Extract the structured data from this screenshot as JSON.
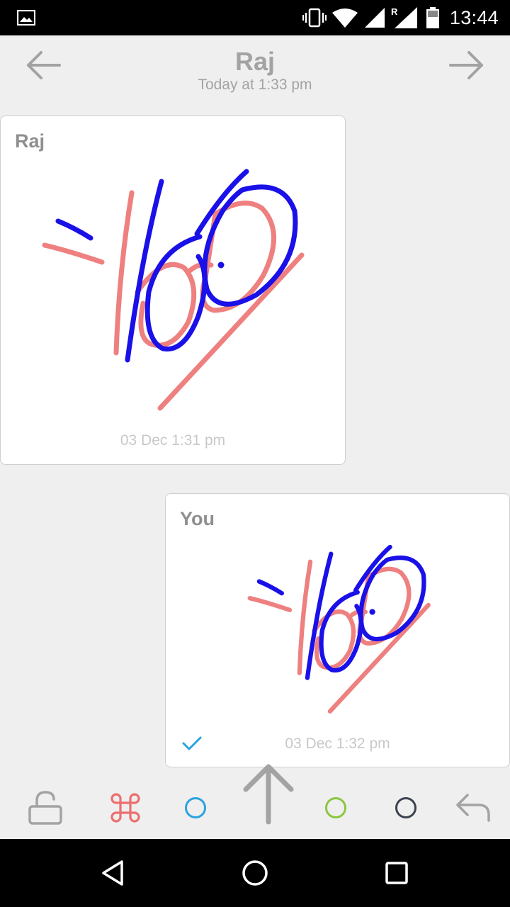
{
  "status_bar": {
    "time": "13:44",
    "icons": [
      "image-icon",
      "vibrate-icon",
      "wifi-icon",
      "signal-icon",
      "roaming-signal-icon",
      "battery-icon"
    ]
  },
  "header": {
    "title": "Raj",
    "subtitle": "Today at 1:33 pm",
    "back_icon": "arrow-left-icon",
    "forward_icon": "arrow-right-icon"
  },
  "messages": [
    {
      "sender": "Raj",
      "time": "03 Dec 1:31 pm",
      "direction": "received",
      "content": "drawing"
    },
    {
      "sender": "You",
      "time": "03 Dec 1:32 pm",
      "direction": "sent",
      "status_icon": "check-icon",
      "content": "drawing"
    }
  ],
  "colors": {
    "ink_blue": "#1a10e8",
    "ink_pink": "#ee8080",
    "tool_red": "#ec6f6f",
    "tool_blue": "#2aa3e0",
    "tool_green": "#8cc63f",
    "tool_dark": "#3b4350",
    "check_blue": "#2aa3e0",
    "muted_gray": "#a3a3a3"
  },
  "toolbar": {
    "tools": [
      "lock-icon",
      "command-icon",
      "blue-color-icon",
      "send-arrow-icon",
      "green-color-icon",
      "dark-color-icon",
      "undo-icon"
    ]
  },
  "navigation_bar": {
    "buttons": [
      "back-triangle-icon",
      "home-circle-icon",
      "recents-square-icon"
    ]
  }
}
